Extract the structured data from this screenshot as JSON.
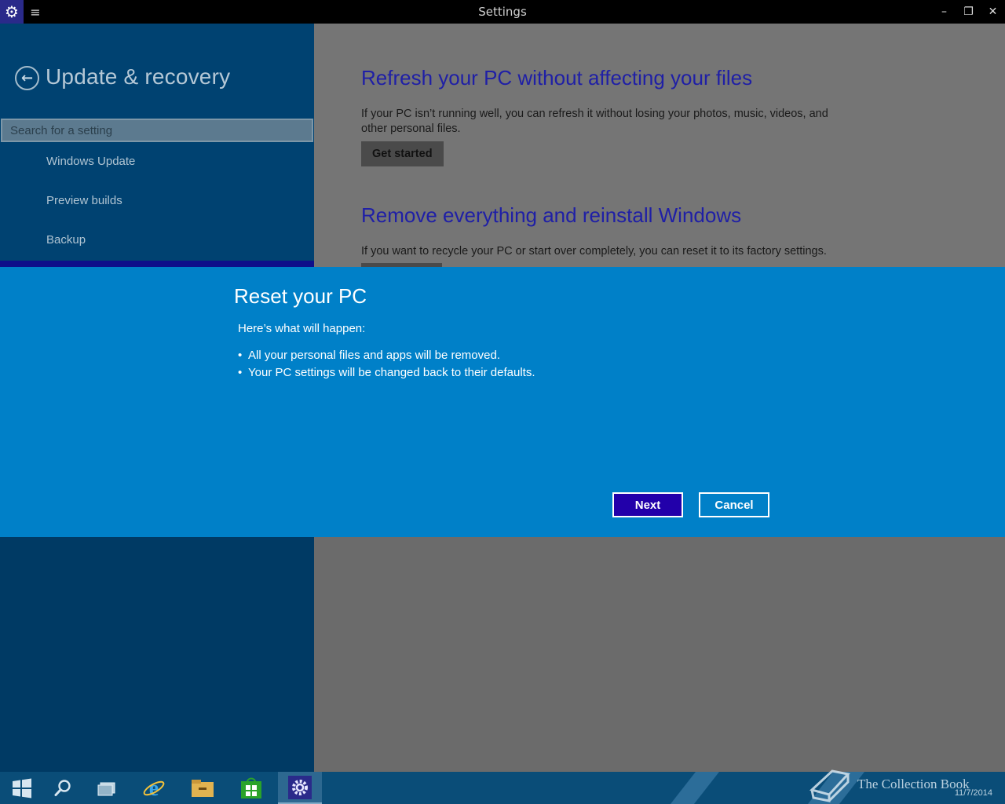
{
  "window": {
    "title": "Settings",
    "minimize_glyph": "–",
    "restore_glyph": "❐",
    "close_glyph": "✕"
  },
  "sidebar": {
    "title": "Update & recovery",
    "search_placeholder": "Search for a setting",
    "items": [
      {
        "label": "Windows Update"
      },
      {
        "label": "Preview builds"
      },
      {
        "label": "Backup"
      }
    ]
  },
  "content": {
    "refresh": {
      "heading": "Refresh your PC without affecting your files",
      "description": "If your PC isn’t running well, you can refresh it without losing your photos, music, videos, and other personal files.",
      "button": "Get started"
    },
    "reset": {
      "heading": "Remove everything and reinstall Windows",
      "description": "If you want to recycle your PC or start over completely, you can reset it to its factory settings."
    }
  },
  "dialog": {
    "title": "Reset your PC",
    "subtitle": "Here’s what will happen:",
    "bullets": [
      "All your personal files and apps will be removed.",
      "Your PC settings will be changed back to their defaults."
    ],
    "next_label": "Next",
    "cancel_label": "Cancel"
  },
  "taskbar": {
    "items": [
      "start-icon",
      "search-icon",
      "task-view-icon",
      "internet-explorer-icon",
      "file-explorer-icon",
      "store-icon",
      "settings-icon"
    ],
    "watermark": "The Collection Book",
    "date": "11/7/2014"
  },
  "colors": {
    "accent": "#0080c8",
    "sidebar": "#003a64",
    "heading": "#1f1fa6",
    "next_button": "#2200aa"
  }
}
